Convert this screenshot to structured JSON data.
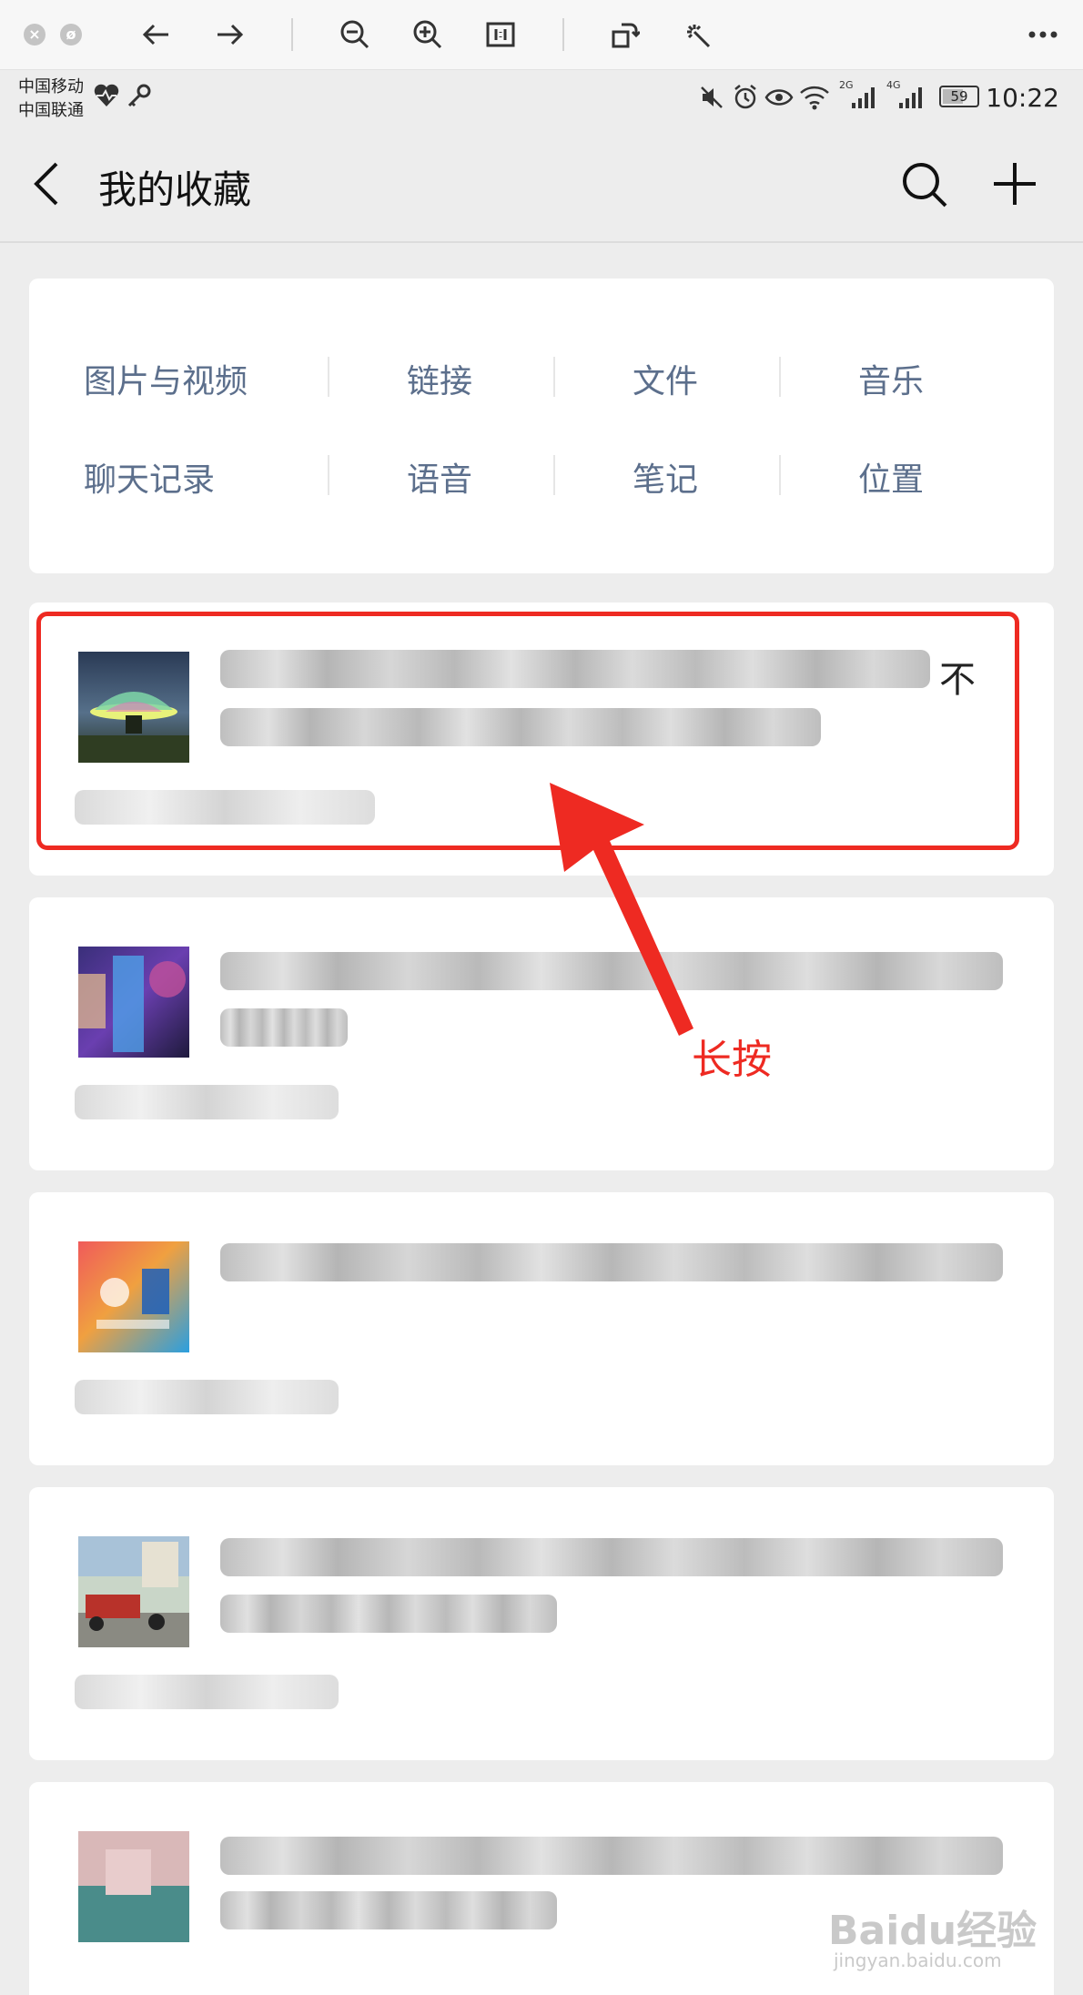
{
  "status": {
    "carrier_1": "中国移动",
    "carrier_2": "中国联通",
    "time": "10:22",
    "battery": "59",
    "network_1": "2G",
    "network_2": "4G"
  },
  "header": {
    "title": "我的收藏"
  },
  "categories": [
    "图片与视频",
    "链接",
    "文件",
    "音乐",
    "聊天记录",
    "语音",
    "笔记",
    "位置"
  ],
  "items": [
    {
      "visible_fragment": "不"
    },
    {
      "visible_fragment": ""
    },
    {
      "visible_fragment": ""
    },
    {
      "visible_fragment": ""
    },
    {
      "visible_fragment": ""
    }
  ],
  "annotation": {
    "text": "长按"
  },
  "watermark": {
    "brand": "Baidu经验",
    "url": "jingyan.baidu.com"
  },
  "colors": {
    "annotation_red": "#ee2a22",
    "category_text": "#5c6f8c",
    "background": "#ededed"
  }
}
